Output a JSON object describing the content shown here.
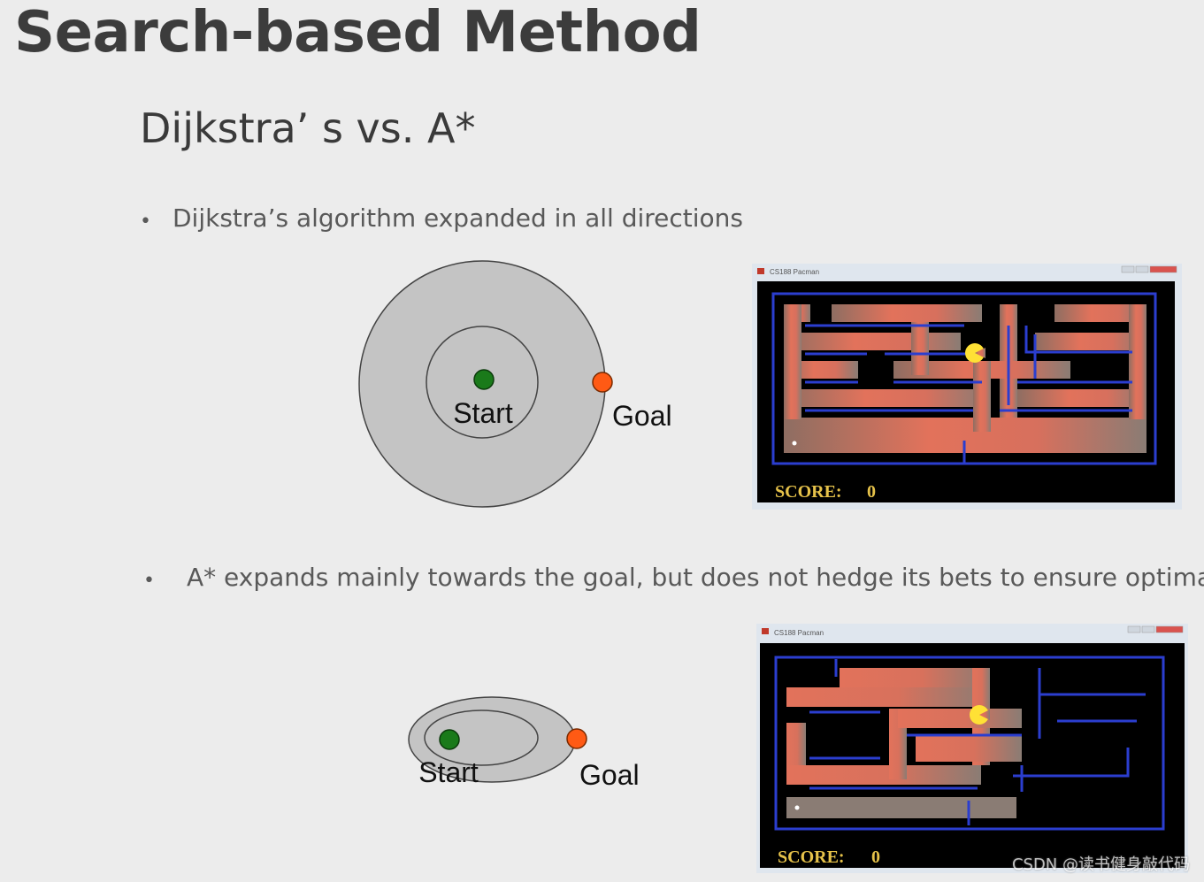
{
  "slide": {
    "title": "Search-based Method",
    "subtitle": "Dijkstra’ s vs. A*",
    "bullets": [
      "Dijkstra’s algorithm expanded in all directions",
      "A* expands mainly towards the goal, but does not hedge its bets to ensure optimality"
    ],
    "bullet_marker": "•"
  },
  "diagrams": {
    "dijkstra": {
      "start_label": "Start",
      "goal_label": "Goal"
    },
    "astar": {
      "start_label": "Start",
      "goal_label": "Goal"
    }
  },
  "games": {
    "top": {
      "window_title": "CS188 Pacman",
      "score_label": "SCORE:",
      "score_value": "0"
    },
    "bottom": {
      "window_title": "CS188 Pacman",
      "score_label": "SCORE:",
      "score_value": "0"
    }
  },
  "watermark": "CSDN @读书健身敲代码",
  "colors": {
    "start": "#1a7a1a",
    "goal": "#ff5a14",
    "explored_region": "#c4c4c4",
    "maze_wall": "#2b3ecf",
    "maze_path": "#e2725b",
    "pacman": "#ffe135"
  }
}
